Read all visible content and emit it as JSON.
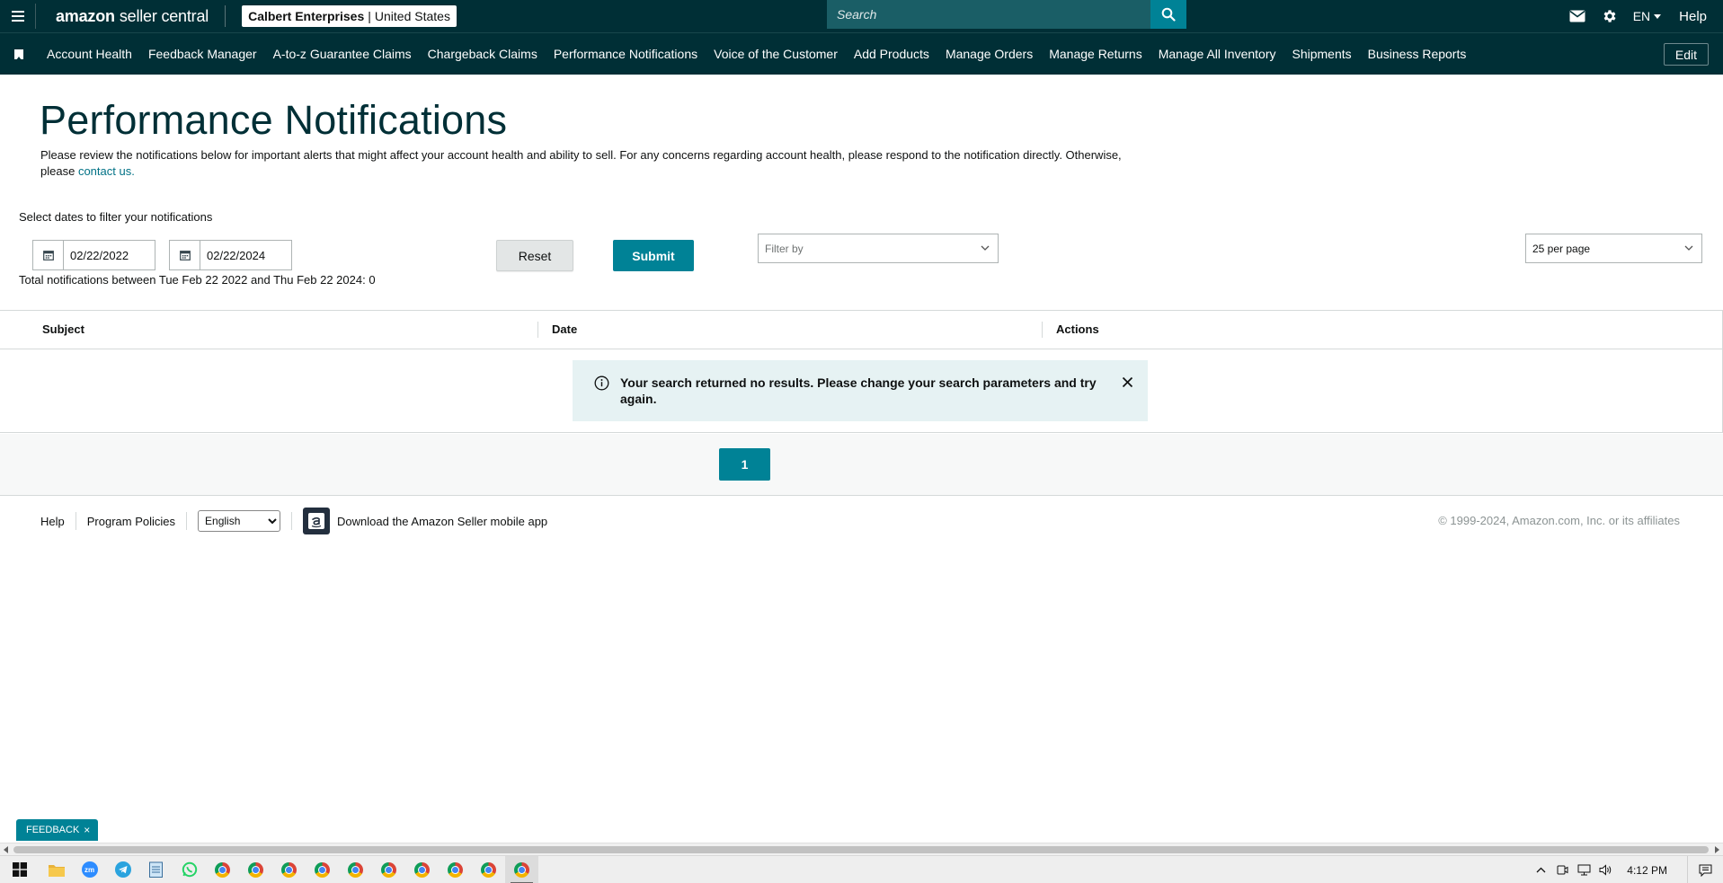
{
  "topbar": {
    "logo_brand": "amazon",
    "logo_product": "seller central",
    "account_name": "Calbert Enterprises",
    "account_region": "United States",
    "search_placeholder": "Search",
    "language": "EN",
    "help": "Help",
    "icons": [
      "menu-icon",
      "mail-icon",
      "gear-icon",
      "search-icon"
    ]
  },
  "nav": {
    "items": [
      "Account Health",
      "Feedback Manager",
      "A-to-z Guarantee Claims",
      "Chargeback Claims",
      "Performance Notifications",
      "Voice of the Customer",
      "Add Products",
      "Manage Orders",
      "Manage Returns",
      "Manage All Inventory",
      "Shipments",
      "Business Reports"
    ],
    "edit": "Edit"
  },
  "page": {
    "title": "Performance Notifications",
    "intro": "Please review the notifications below for important alerts that might affect your account health and ability to sell. For any concerns regarding account health, please respond to the notification directly. Otherwise, please",
    "contact_link": "contact us.",
    "filter_label": "Select dates to filter your notifications",
    "start_date": "02/22/2022",
    "end_date": "02/22/2024",
    "reset": "Reset",
    "submit": "Submit",
    "filter_by_placeholder": "Filter by",
    "per_page": "25 per page",
    "total": "Total notifications between Tue Feb 22 2022 and Thu Feb 22 2024: 0"
  },
  "table": {
    "columns": [
      "Subject",
      "Date",
      "Actions"
    ],
    "empty_message": "Your search returned no results. Please change your search parameters and try again."
  },
  "pagination": {
    "current_page": "1"
  },
  "footer": {
    "help": "Help",
    "program_policies": "Program Policies",
    "language": "English",
    "app_download": "Download the Amazon Seller mobile app",
    "copyright": "© 1999-2024, Amazon.com, Inc. or its affiliates"
  },
  "feedback": {
    "label": "FEEDBACK",
    "close": "×"
  },
  "taskbar": {
    "time": "4:12 PM",
    "apps": [
      "file-explorer",
      "zoom",
      "telegram",
      "notepad",
      "whatsapp",
      "chrome",
      "chrome",
      "chrome",
      "chrome",
      "chrome",
      "chrome",
      "chrome",
      "chrome",
      "chrome",
      "chrome"
    ],
    "zoom_label": "zm"
  },
  "colors": {
    "header_bg": "#002f36",
    "accent": "#008296",
    "link": "#007185",
    "alert_bg": "#e6f2f3"
  }
}
